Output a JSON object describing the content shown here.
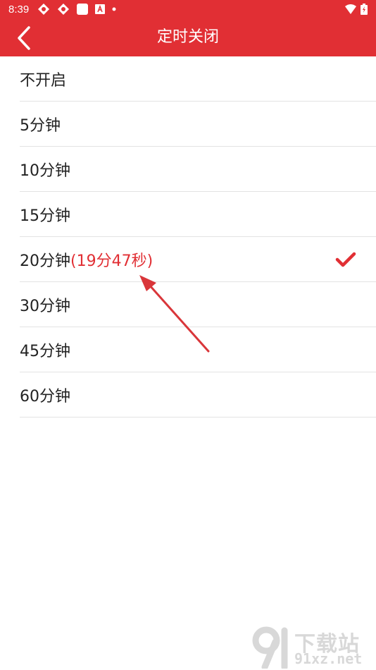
{
  "status_bar": {
    "time": "8:39",
    "icons": [
      "notification-app-icon",
      "notification-app-icon",
      "square-notification-icon",
      "a-notification-icon",
      "dot-icon"
    ],
    "right_icons": [
      "wifi-icon",
      "battery-charging-icon"
    ]
  },
  "header": {
    "title": "定时关闭",
    "back_icon": "chevron-left-icon"
  },
  "options": [
    {
      "label": "不开启",
      "countdown": "",
      "selected": false
    },
    {
      "label": "5分钟",
      "countdown": "",
      "selected": false
    },
    {
      "label": "10分钟",
      "countdown": "",
      "selected": false
    },
    {
      "label": "15分钟",
      "countdown": "",
      "selected": false
    },
    {
      "label": "20分钟",
      "countdown": "(19分47秒)",
      "selected": true
    },
    {
      "label": "30分钟",
      "countdown": "",
      "selected": false
    },
    {
      "label": "45分钟",
      "countdown": "",
      "selected": false
    },
    {
      "label": "60分钟",
      "countdown": "",
      "selected": false
    }
  ],
  "watermark": {
    "line1": "下载站",
    "line2": "91xz.net"
  },
  "colors": {
    "accent": "#e12f34",
    "text": "#222222",
    "divider": "#e3e3e3",
    "watermark": "#d8d8d8"
  }
}
